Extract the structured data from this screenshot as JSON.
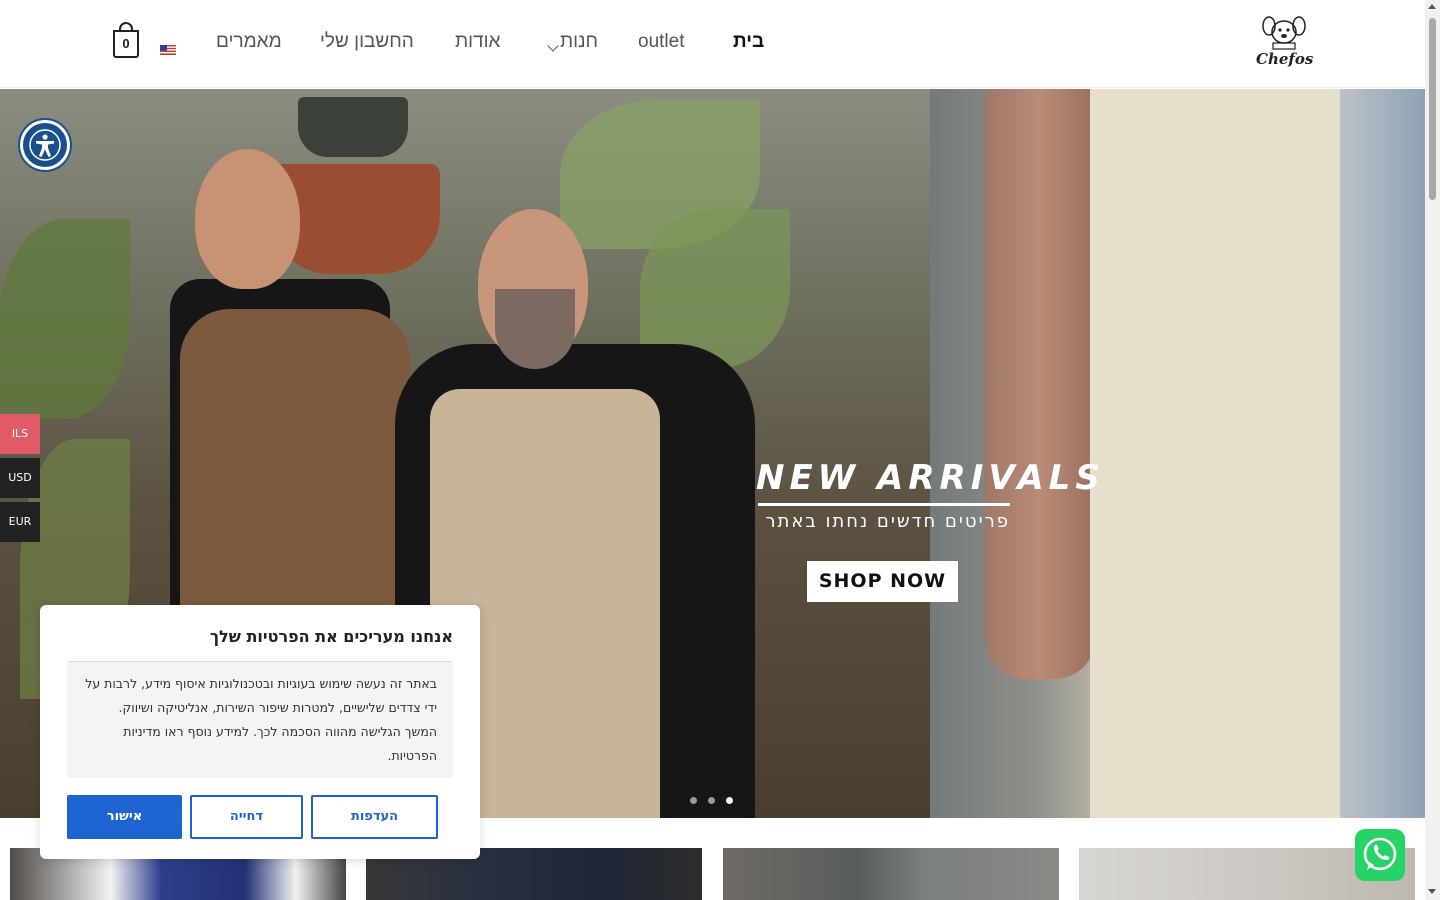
{
  "header": {
    "logo_text": "Chefos",
    "nav": [
      {
        "label": "בית",
        "active": true
      },
      {
        "label": "outlet",
        "active": false
      },
      {
        "label": "חנות",
        "active": false,
        "has_dropdown": true
      },
      {
        "label": "אודות",
        "active": false
      },
      {
        "label": "החשבון שלי",
        "active": false
      },
      {
        "label": "מאמרים",
        "active": false
      }
    ],
    "cart_count": "0",
    "language_flag": "us-flag-icon"
  },
  "hero": {
    "title": "NEW ARRIVALS",
    "subtitle": "פריטים חדשים נחתו באתר",
    "cta_label": "SHOP NOW",
    "slide_count": 3,
    "active_slide": 3
  },
  "currency_switcher": {
    "options": [
      "ILS",
      "USD",
      "EUR"
    ],
    "selected": "ILS"
  },
  "cookie_notice": {
    "title": "אנחנו מעריכים את הפרטיות שלך",
    "body": "באתר זה נעשה שימוש בעוגיות ובטכנולוגיות איסוף מידע, לרבות על ידי צדדים שלישיים, למטרות שיפור השירות, אנליטיקה ושיווק. המשך הגלישה מהווה הסכמה לכך. למידע נוסף ראו מדיניות הפרטיות.",
    "accept_label": "אישור",
    "reject_label": "דחייה",
    "preferences_label": "העדפות"
  },
  "colors": {
    "accent_blue": "#1e63d2",
    "accessibility_blue": "#1a4f8d",
    "currency_active": "#e05a67",
    "whatsapp_green": "#25d366"
  },
  "icons": {
    "accessibility": "accessibility-icon",
    "cart": "cart-icon",
    "whatsapp": "whatsapp-icon",
    "dropdown": "chevron-down-icon"
  }
}
